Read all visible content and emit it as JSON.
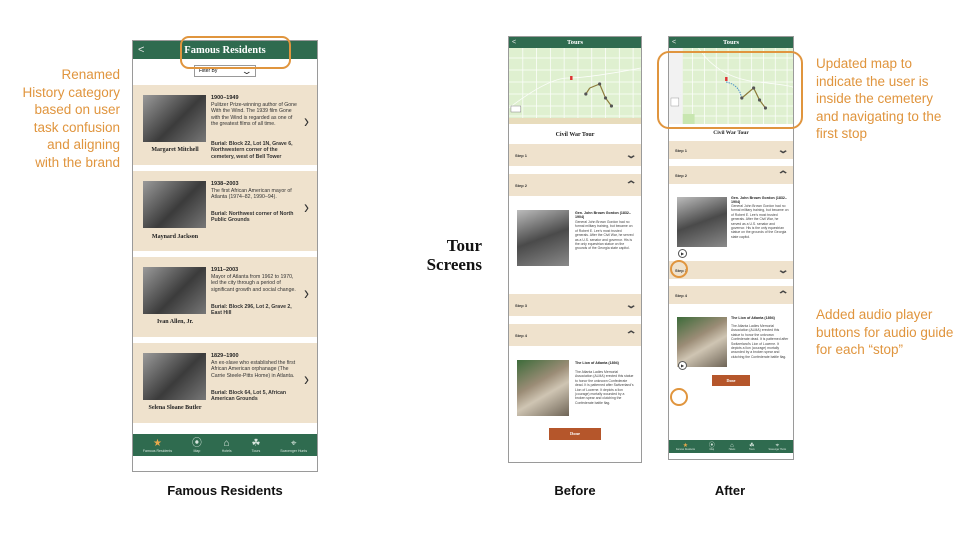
{
  "annotations": {
    "renamed": "Renamed History category based on user task confusion and aligning with the brand",
    "map_update": "Updated map to indicate the user is inside the cemetery and navigating to the first stop",
    "audio": "Added audio player buttons for audio guide for each “stop”"
  },
  "captions": {
    "famous_residents": "Famous Residents",
    "before": "Before",
    "after": "After"
  },
  "section_label": "Tour Screens",
  "colors": {
    "header_green": "#2f6b4f",
    "card_beige": "#efe2cd",
    "accent_orange": "#e0953e",
    "done_button": "#b5562b"
  },
  "famous_residents_screen": {
    "back_icon": "<",
    "title": "Famous Residents",
    "filter_label": "Filter By",
    "residents": [
      {
        "name": "Margaret Mitchell",
        "years": "1900–1949",
        "description": "Pulitzer Prize-winning author of Gone With the Wind. The 1939 film Gone with the Wind is regarded as one of the greatest films of all time.",
        "burial": "Burial: Block 22, Lot 1N, Grave 6, Northwestern corner of the cemetery, west of Bell Tower"
      },
      {
        "name": "Maynard Jackson",
        "years": "1938–2003",
        "description": "The first African American mayor of Atlanta (1974–82, 1990–94).",
        "burial": "Burial: Northwest corner of North Public Grounds"
      },
      {
        "name": "Ivan Allen, Jr.",
        "years": "1911–2003",
        "description": "Mayor of Atlanta from 1962 to 1970, led the city through a period of significant growth and social change.",
        "burial": "Burial: Block 296, Lot 2, Grave 2, East Hill"
      },
      {
        "name": "Selena Sloane Butler",
        "years": "1829–1900",
        "description": "An ex-slave who established the first African American orphanage (The Carrie Steele-Pitts Home) in Atlanta.",
        "burial": "Burial: Block 64, Lot 5, African American Grounds"
      }
    ],
    "tabs": [
      {
        "label": "Famous Residents",
        "icon": "★",
        "active": true
      },
      {
        "label": "Map",
        "icon": "⦿",
        "active": false
      },
      {
        "label": "Hotels",
        "icon": "⌂",
        "active": false
      },
      {
        "label": "Tours",
        "icon": "☘",
        "active": false
      },
      {
        "label": "Scavenger Hunts",
        "icon": "⌖",
        "active": false
      }
    ]
  },
  "tour_screen": {
    "back_icon": "<",
    "title": "Tours",
    "tour_name": "Civil War Tour",
    "steps": [
      {
        "label": "Step 1",
        "expanded": false
      },
      {
        "label": "Step 2",
        "expanded": true
      },
      {
        "label": "Step 3",
        "expanded": false
      },
      {
        "label": "Step 4",
        "expanded": true
      }
    ],
    "step2_detail": {
      "title": "Gen. John Brown Gordon (1832–1904)",
      "text": "General John Brown Gordon had no formal military training, but became on of Robert E. Lee's most trusted generals. After the Civil War, he served as a U.S. senator and governor. His is the only equestrian statue on the grounds of the Georgia state capitol."
    },
    "step4_detail": {
      "title": "The Lion of Atlanta (1894)",
      "text": "The Atlanta Ladies Memorial Association (ALMA) erected this statue to honor the unknown Confederate dead. It is patterned after Switzerland's Lion of Lucerne. It depicts a lion (courage) mortally wounded by a broken spear and clutching the Confederate battle flag."
    },
    "done_label": "Done",
    "play_icon": "▶"
  }
}
